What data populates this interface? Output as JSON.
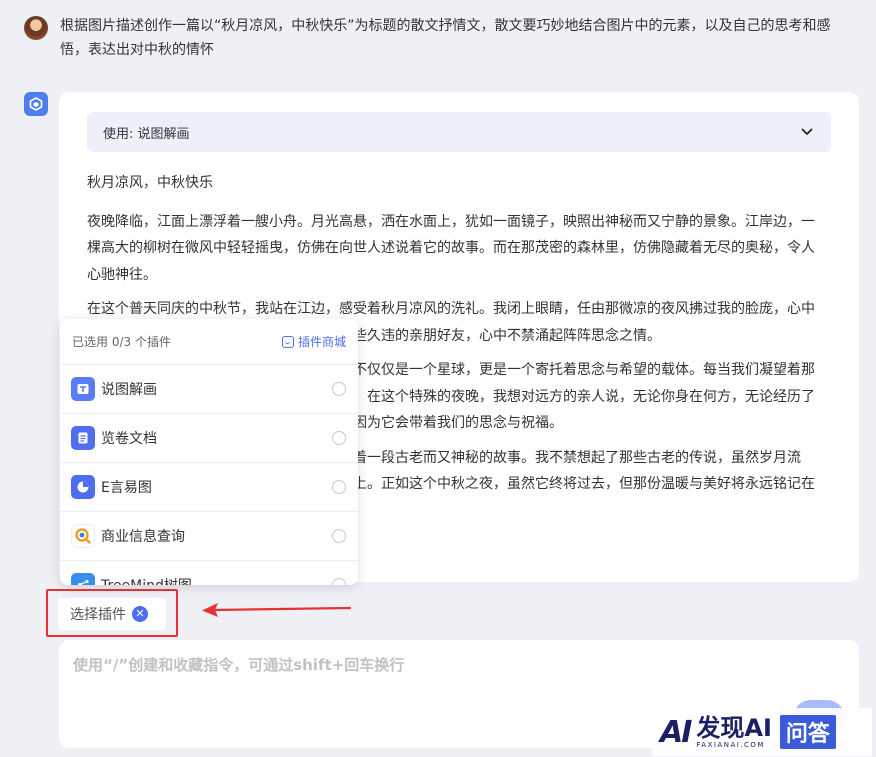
{
  "conversation": {
    "user_prompt": "根据图片描述创作一篇以“秋月凉风，中秋快乐”为标题的散文抒情文，散文要巧妙地结合图片中的元素，以及自己的思考和感悟，表达出对中秋的情怀"
  },
  "answer": {
    "plugin_used_label": "使用: 说图解画",
    "title": "秋月凉风，中秋快乐",
    "paragraphs": [
      "夜晚降临，江面上漂浮着一艘小舟。月光高悬，洒在水面上，犹如一面镜子，映照出神秘而又宁静的景象。江岸边，一棵高大的柳树在微风中轻轻摇曳，仿佛在向世人述说着它的故事。而在那茂密的森林里，仿佛隐藏着无尽的奥秘，令人心驰神往。",
      "在这个普天同庆的中秋节，我站在江边，感受着秋月凉风的洗礼。我闭上眼睛，任由那微凉的夜风拂过我的脸庞，心中不禁想起了那些古老的神话传说，想起了那些久违的亲朋好友，心中不禁涌起阵阵思念之情。",
      "今夜的月亮格外明亮，在这个中秋之夜，它不仅仅是一个星球，更是一个寄托着思念与希望的载体。每当我们凝望着那轮明月，总会情不自禁地仰望它，感慨万千。在这个特殊的夜晚，我想对远方的亲人说，无论你身在何方，无论经历了什么，都不要忘记抬头看看那高悬的月亮，因为它会带着我们的思念与祝福。",
      "江边的柳树在风中轻轻摇曳着，仿佛在诉说着一段古老而又神秘的故事。我不禁想起了那些古老的传说，虽然岁月流逝，但它们的遗产却永久地留在了这片大地上。正如这个中秋之夜，虽然它终将过去，但那份温暖与美好将永远铭记在心。"
    ]
  },
  "plugin_popup": {
    "selected_count": "已选用 0/3 个插件",
    "store_label": "插件商城",
    "items": [
      {
        "name": "说图解画",
        "icon": "image-explain-icon",
        "color": "#5b7cf6"
      },
      {
        "name": "览卷文档",
        "icon": "document-icon",
        "color": "#4f6ff0"
      },
      {
        "name": "E言易图",
        "icon": "pie-chart-icon",
        "color": "#4e6ef2"
      },
      {
        "name": "商业信息查询",
        "icon": "business-search-icon",
        "color": "#f0a020"
      },
      {
        "name": "TreeMind树图",
        "icon": "mindmap-icon",
        "color": "#3c8df0"
      }
    ]
  },
  "chip": {
    "label": "选择插件",
    "close_symbol": "✕"
  },
  "input": {
    "placeholder": "使用“/”创建和收藏指令，可通过shift+回车换行"
  },
  "watermark": {
    "logo": "AI",
    "main": "发现AI",
    "sub": "FAXIANAI.COM",
    "badge": "问答"
  },
  "colors": {
    "accent": "#4e6ef2",
    "highlight_red": "#e53333"
  }
}
